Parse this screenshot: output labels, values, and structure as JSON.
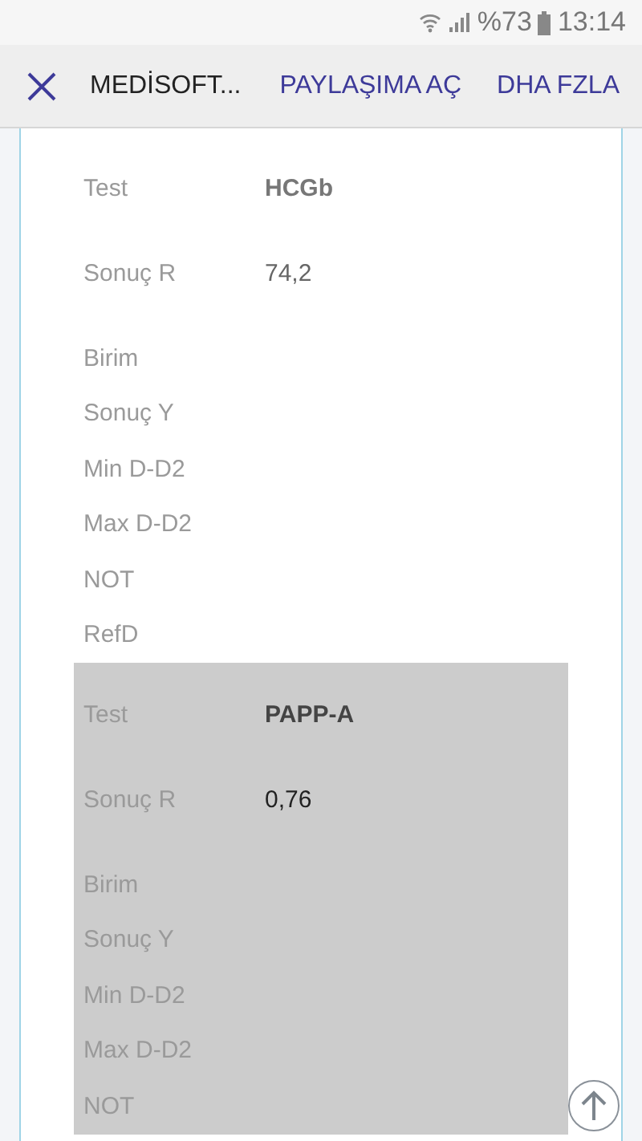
{
  "status_bar": {
    "battery": "%73",
    "time": "13:14"
  },
  "toolbar": {
    "title": "MEDİSOFT...",
    "actions": [
      "PAYLAŞIMA AÇ",
      "DHA FZLA"
    ]
  },
  "records": [
    {
      "highlighted": false,
      "rows": [
        {
          "label": "Test",
          "value": "HCGb"
        },
        {
          "label": "Sonuç R",
          "value": "74,2"
        },
        {
          "label": "Birim"
        },
        {
          "label": "Sonuç Y"
        },
        {
          "label": "Min D-D2"
        },
        {
          "label": "Max D-D2"
        },
        {
          "label": "NOT"
        },
        {
          "label": "RefD"
        }
      ]
    },
    {
      "highlighted": true,
      "rows": [
        {
          "label": "Test",
          "value": "PAPP-A"
        },
        {
          "label": "Sonuç R",
          "value": "0,76"
        },
        {
          "label": "Birim"
        },
        {
          "label": "Sonuç Y"
        },
        {
          "label": "Min D-D2"
        },
        {
          "label": "Max D-D2"
        },
        {
          "label": "NOT"
        }
      ]
    }
  ]
}
